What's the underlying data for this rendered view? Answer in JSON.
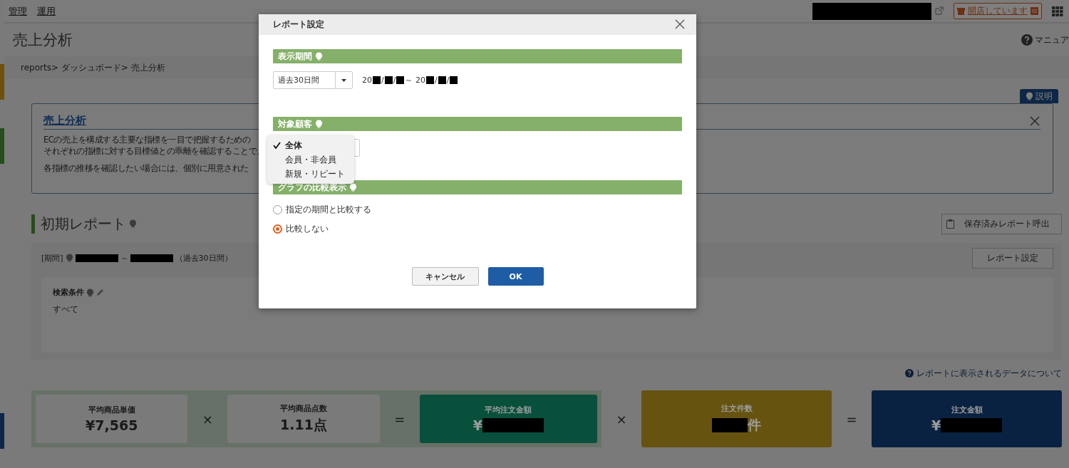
{
  "top_nav": {
    "links": [
      {
        "label": "管理"
      },
      {
        "label": "運用"
      }
    ],
    "store_status": "開店しています"
  },
  "page_title": "売上分析",
  "manual_link": "マニュア",
  "breadcrumb": "reports> ダッシュボード> 売上分析",
  "explain_tab": "説明",
  "info_box": {
    "title": "売上分析",
    "lines": [
      "ECの売上を構成する主要な指標を一目で把握するための",
      "それぞれの指標に対する目標値との乖離を確認することで、",
      "各指標の推移を確認したい場合には、個別に用意された"
    ]
  },
  "report": {
    "title": "初期レポート",
    "saved_button": "保存済みレポート呼出",
    "period_label": "[期間]",
    "period_separator": "～",
    "period_note": "（過去30日間）",
    "settings_button": "レポート設定",
    "conditions_label": "検索条件",
    "conditions_value": "すべて"
  },
  "data_link": "レポートに表示されるデータについて",
  "metrics": {
    "group": [
      {
        "kind": "card",
        "label": "平均商品単価",
        "value": [
          {
            "kind": "text",
            "text": "¥7,565"
          }
        ]
      },
      {
        "kind": "operator",
        "text": "×"
      },
      {
        "kind": "card",
        "label": "平均商品点数",
        "value": [
          {
            "kind": "text",
            "text": "1.11点"
          }
        ]
      },
      {
        "kind": "operator",
        "text": "="
      },
      {
        "kind": "colored",
        "color": "#08503c",
        "label": "平均注文金額",
        "value": [
          {
            "kind": "text",
            "text": "¥"
          },
          {
            "kind": "redacted"
          }
        ]
      }
    ],
    "rest": [
      {
        "kind": "operator",
        "text": "×"
      },
      {
        "kind": "colored",
        "color": "#65530f",
        "label": "注文件数",
        "value": [
          {
            "kind": "redacted"
          },
          {
            "kind": "text",
            "text": "件"
          }
        ]
      },
      {
        "kind": "operator",
        "text": "="
      },
      {
        "kind": "colored",
        "color": "#0a2241",
        "label": "注文金額",
        "value": [
          {
            "kind": "text",
            "text": "¥"
          },
          {
            "kind": "redacted"
          }
        ]
      }
    ]
  },
  "dialog": {
    "title": "レポート設定",
    "period": {
      "title": "表示期間",
      "select": "過去30日間",
      "date_range": [
        {
          "kind": "text",
          "text": "20"
        },
        {
          "kind": "redacted"
        },
        {
          "kind": "text",
          "text": "/"
        },
        {
          "kind": "redacted"
        },
        {
          "kind": "text",
          "text": "/"
        },
        {
          "kind": "redacted"
        },
        {
          "kind": "text",
          "text": "～ 20"
        },
        {
          "kind": "redacted"
        },
        {
          "kind": "text",
          "text": "/"
        },
        {
          "kind": "redacted"
        },
        {
          "kind": "text",
          "text": "/"
        },
        {
          "kind": "redacted"
        }
      ]
    },
    "customer": {
      "title": "対象顧客",
      "options": [
        {
          "label": "全体",
          "selected": true
        },
        {
          "label": "会員・非会員",
          "selected": false
        },
        {
          "label": "新規・リピート",
          "selected": false
        }
      ]
    },
    "compare": {
      "title": "グラフの比較表示",
      "options": [
        {
          "label": "指定の期間と比較する",
          "selected": false
        },
        {
          "label": "比較しない",
          "selected": true
        }
      ]
    },
    "buttons": [
      {
        "label": "キャンセル",
        "kind": "secondary"
      },
      {
        "label": "OK",
        "kind": "primary"
      }
    ]
  }
}
